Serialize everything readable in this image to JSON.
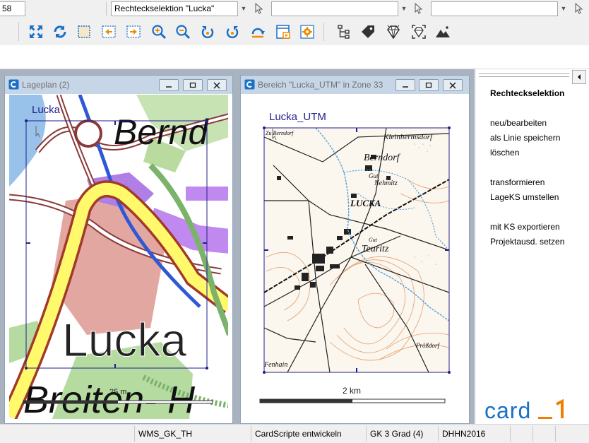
{
  "combo_row": {
    "first_value": "58",
    "selection_value": "Rechteckselektion \"Lucka\"",
    "combo3_value": "",
    "combo4_value": ""
  },
  "toolbar": {
    "icons": [
      "zoom-all-icon",
      "refresh-icon",
      "select-rect-icon",
      "prev-view-icon",
      "next-view-icon",
      "zoom-in-icon",
      "zoom-out-icon",
      "rotate-left-icon",
      "rotate-right-icon",
      "reset-rotation-icon",
      "print-layout-icon",
      "settings-icon",
      "tree-icon",
      "tag-icon",
      "diamond-icon",
      "diamond-frame-icon",
      "terrain-icon"
    ]
  },
  "windows": {
    "lageplan": {
      "title": "Lageplan (2)",
      "map_label": "Lucka",
      "town_big_label": "Lucka",
      "place_label_top": "Bernd",
      "place_label_bottom": "Breiten- H",
      "scale_text": "25 m"
    },
    "bereich": {
      "title": "Bereich \"Lucka_UTM\" in Zone 33",
      "map_label": "Lucka_UTM",
      "scale_text": "2 km",
      "topo_labels": [
        "Berndorf",
        "Kleinhermsdorf",
        "LUCKA",
        "Teuritz",
        "Nehmitz",
        "Gut",
        "Prößdorf",
        "Fenhain",
        "Zu Berndorf",
        "Gut"
      ]
    }
  },
  "side_panel": {
    "heading": "Rechteckselektion",
    "items": [
      "neu/bearbeiten",
      "als Linie speichern",
      "löschen",
      "transformieren",
      "LageKS umstellen",
      "mit KS exportieren",
      "Projektausd. setzen"
    ],
    "logo_text": "card_1"
  },
  "status_bar": {
    "cells": [
      "",
      "WMS_GK_TH",
      "CardScripte entwickeln",
      "GK 3 Grad (4)",
      "DHHN2016",
      "",
      "",
      ""
    ]
  },
  "colors": {
    "accent_blue": "#1a6fc7",
    "selection_frame": "#1f1f8c",
    "logo_blue": "#1a6fc7",
    "logo_orange": "#f07d00"
  }
}
